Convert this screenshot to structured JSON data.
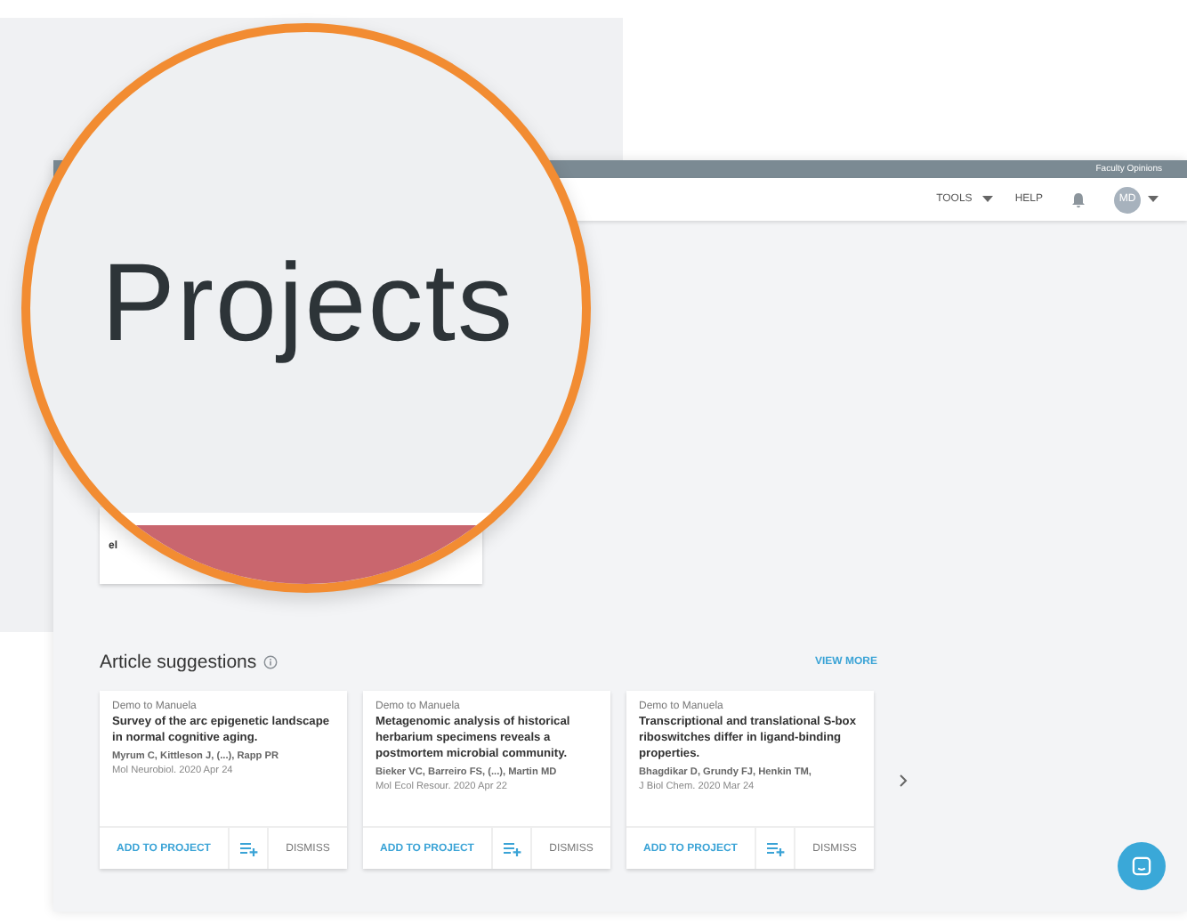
{
  "brand_bar": {
    "label": "Faculty Opinions"
  },
  "header": {
    "menu": [
      {
        "label": "TOOLS",
        "kind": "dropdown"
      },
      {
        "label": "HELP",
        "kind": "link"
      }
    ],
    "avatar": "MD"
  },
  "magnifier": {
    "heading": "Projects"
  },
  "project_card": {
    "text": "el"
  },
  "suggestions": {
    "title": "Article suggestions",
    "view_more": "VIEW MORE",
    "articles": [
      {
        "source": "Demo to Manuela",
        "title": "Survey of the arc epigenetic landscape in normal cognitive aging.",
        "authors": "Myrum C, Kittleson J, (...), Rapp PR",
        "journal": "Mol Neurobiol. 2020 Apr 24",
        "add": "ADD TO PROJECT",
        "dismiss": "DISMISS"
      },
      {
        "source": "Demo to Manuela",
        "title": "Metagenomic analysis of historical herbarium specimens reveals a postmortem microbial community.",
        "authors": "Bieker VC, Barreiro FS, (...), Martin MD",
        "journal": "Mol Ecol Resour. 2020 Apr 22",
        "add": "ADD TO PROJECT",
        "dismiss": "DISMISS"
      },
      {
        "source": "Demo to Manuela",
        "title": "Transcriptional and translational S-box riboswitches differ in ligand-binding properties.",
        "authors": "Bhagdikar D, Grundy FJ, Henkin TM,",
        "journal": "J Biol Chem. 2020 Mar 24",
        "add": "ADD TO PROJECT",
        "dismiss": "DISMISS"
      }
    ]
  }
}
